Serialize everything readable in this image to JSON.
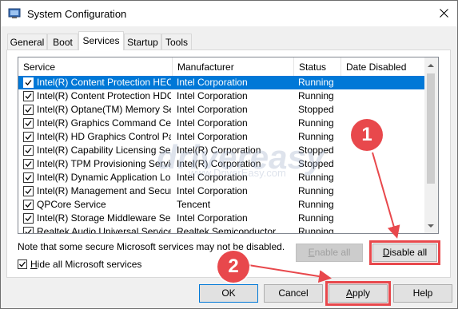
{
  "window": {
    "title": "System Configuration",
    "app_icon": "system-config-icon",
    "close_icon": "close-icon"
  },
  "tabs": [
    {
      "label": "General"
    },
    {
      "label": "Boot"
    },
    {
      "label": "Services",
      "active": true
    },
    {
      "label": "Startup"
    },
    {
      "label": "Tools"
    }
  ],
  "columns": {
    "service": "Service",
    "manufacturer": "Manufacturer",
    "status": "Status",
    "date_disabled": "Date Disabled"
  },
  "services": [
    {
      "name": "Intel(R) Content Protection HEC...",
      "manufacturer": "Intel Corporation",
      "status": "Running",
      "date": "",
      "checked": true,
      "selected": true
    },
    {
      "name": "Intel(R) Content Protection HDC...",
      "manufacturer": "Intel Corporation",
      "status": "Running",
      "date": "",
      "checked": true
    },
    {
      "name": "Intel(R) Optane(TM) Memory Se...",
      "manufacturer": "Intel Corporation",
      "status": "Stopped",
      "date": "",
      "checked": true
    },
    {
      "name": "Intel(R) Graphics Command Cen...",
      "manufacturer": "Intel Corporation",
      "status": "Running",
      "date": "",
      "checked": true
    },
    {
      "name": "Intel(R) HD Graphics Control Pa...",
      "manufacturer": "Intel Corporation",
      "status": "Running",
      "date": "",
      "checked": true
    },
    {
      "name": "Intel(R) Capability Licensing Ser...",
      "manufacturer": "Intel(R) Corporation",
      "status": "Stopped",
      "date": "",
      "checked": true
    },
    {
      "name": "Intel(R) TPM Provisioning Service",
      "manufacturer": "Intel(R) Corporation",
      "status": "Stopped",
      "date": "",
      "checked": true
    },
    {
      "name": "Intel(R) Dynamic Application Loa...",
      "manufacturer": "Intel Corporation",
      "status": "Running",
      "date": "",
      "checked": true
    },
    {
      "name": "Intel(R) Management and Securi...",
      "manufacturer": "Intel Corporation",
      "status": "Running",
      "date": "",
      "checked": true
    },
    {
      "name": "QPCore Service",
      "manufacturer": "Tencent",
      "status": "Running",
      "date": "",
      "checked": true
    },
    {
      "name": "Intel(R) Storage Middleware Ser...",
      "manufacturer": "Intel Corporation",
      "status": "Running",
      "date": "",
      "checked": true
    },
    {
      "name": "Realtek Audio Universal Service",
      "manufacturer": "Realtek Semiconductor",
      "status": "Running",
      "date": "",
      "checked": true
    }
  ],
  "note": "Note that some secure Microsoft services may not be disabled.",
  "enable_all": {
    "prefix": "",
    "accel": "E",
    "rest": "nable all"
  },
  "disable_all": {
    "prefix": "",
    "accel": "D",
    "rest": "isable all"
  },
  "hide_ms": {
    "prefix": "",
    "accel": "H",
    "rest": "ide all Microsoft services",
    "checked": true
  },
  "buttons": {
    "ok": "OK",
    "cancel": "Cancel",
    "apply": {
      "prefix": "",
      "accel": "A",
      "rest": "pply"
    },
    "help": "Help"
  },
  "markers": {
    "step1": "1",
    "step2": "2"
  },
  "watermark": {
    "main": "drivereasy",
    "sub": "www.DriverEasy.com"
  },
  "colors": {
    "selection": "#0078d7",
    "highlight": "#e8484c"
  }
}
